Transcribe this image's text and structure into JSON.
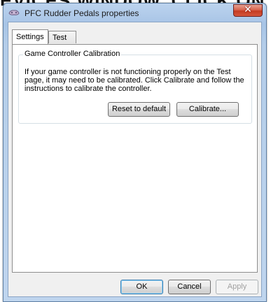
{
  "background": {
    "caption": "EVICES WINDOW, CLICK ON"
  },
  "window": {
    "title": "PFC Rudder Pedals properties",
    "close_glyph": "✕",
    "title_icon": "joystick-icon"
  },
  "tabs": [
    {
      "label": "Settings",
      "active": true
    },
    {
      "label": "Test",
      "active": false
    }
  ],
  "calibration": {
    "group_title": "Game Controller Calibration",
    "description": "If your game controller is not functioning properly on the Test page, it may need to be calibrated.  Click Calibrate and follow the instructions to calibrate the controller.",
    "reset_label": "Reset to default",
    "calibrate_label": "Calibrate..."
  },
  "footer": {
    "ok_label": "OK",
    "cancel_label": "Cancel",
    "apply_label": "Apply"
  },
  "colors": {
    "frame": "#b4cde9",
    "close_button": "#c53b22",
    "panel": "#ffffff"
  }
}
